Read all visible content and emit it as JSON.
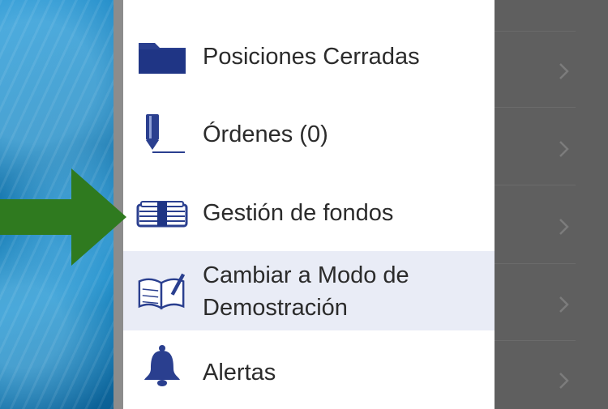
{
  "menu": {
    "items": [
      {
        "label": "Posiciones Cerradas",
        "icon": "folder-icon"
      },
      {
        "label": "Órdenes (0)",
        "icon": "pen-icon"
      },
      {
        "label": "Gestión de fondos",
        "icon": "money-stack-icon"
      },
      {
        "label": "Cambiar a Modo de Demostración",
        "icon": "book-edit-icon",
        "line1": "Cambiar a Modo de",
        "line2": "Demostración",
        "highlighted": true
      },
      {
        "label": "Alertas",
        "icon": "bell-icon"
      }
    ]
  },
  "colors": {
    "icon": "#2a3f8f",
    "highlight": "#e9ecf6",
    "arrow": "#2f7a1f",
    "overlay": "#5f5f5f"
  },
  "overlay": {
    "chevron_icon": "chevron-right-icon"
  }
}
